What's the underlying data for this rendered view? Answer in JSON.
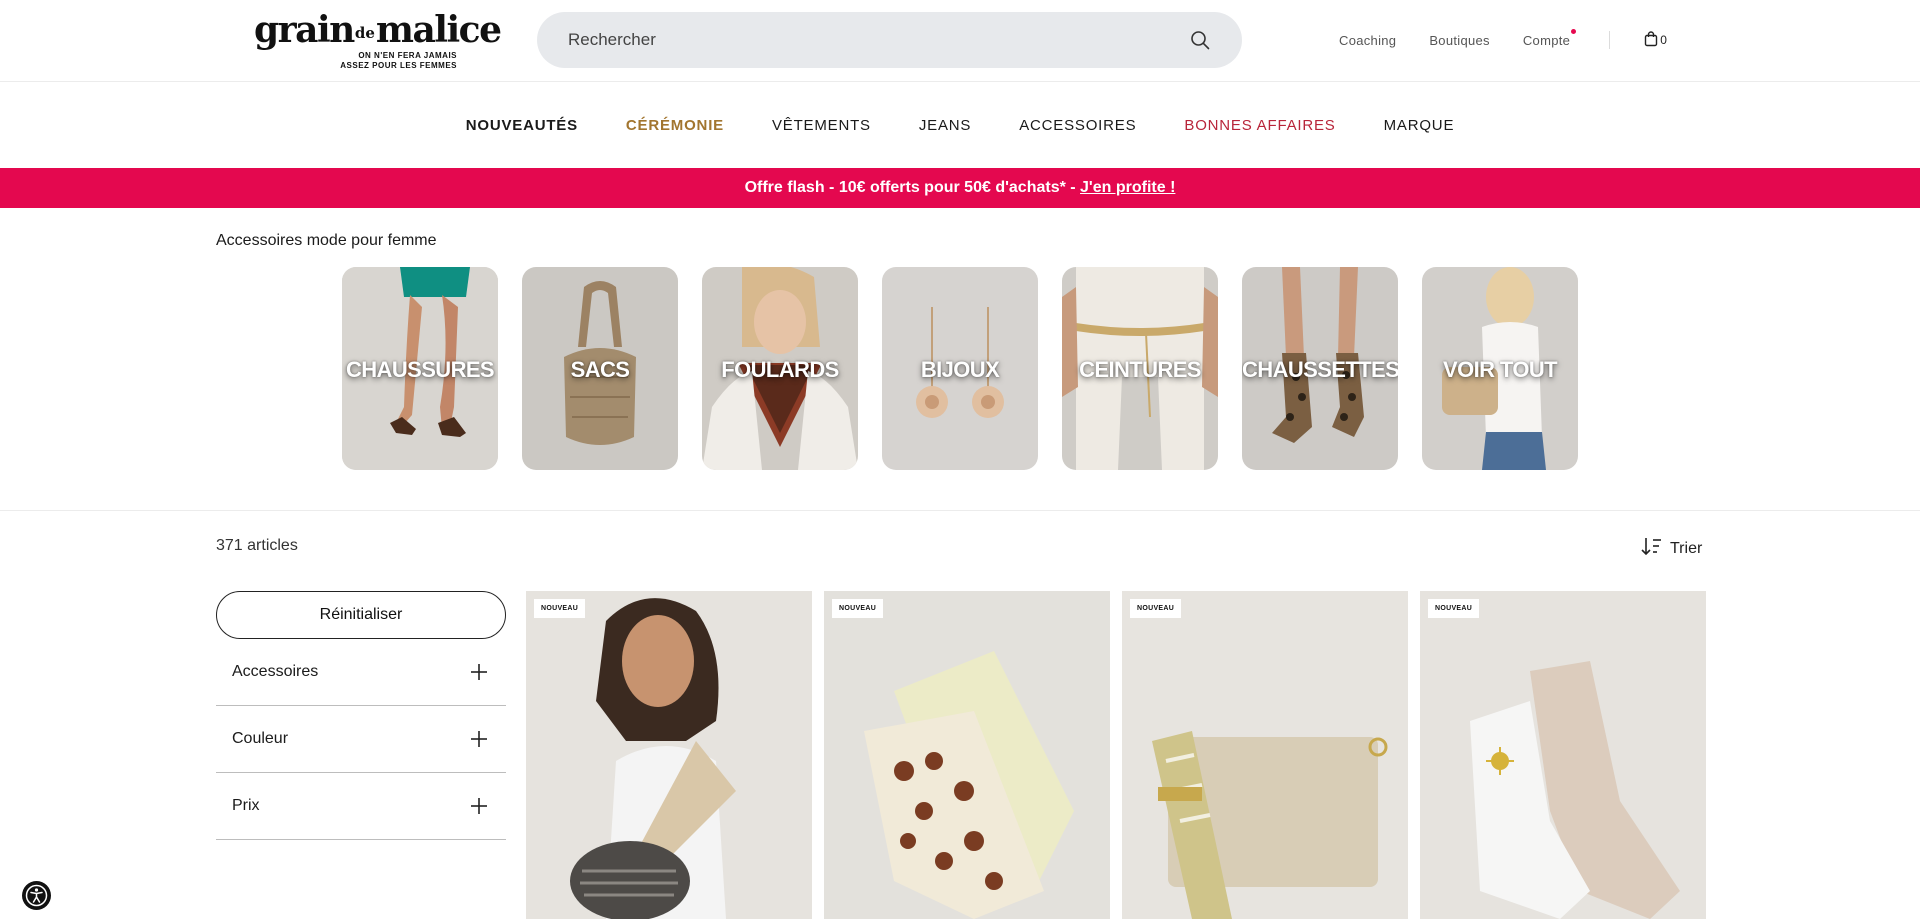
{
  "header": {
    "logo": {
      "word1": "grain",
      "word_de": "de",
      "word2": "malice",
      "tagline_1": "ON N'EN FERA JAMAIS",
      "tagline_2": "ASSEZ POUR LES FEMMES"
    },
    "search": {
      "placeholder": "Rechercher"
    },
    "links": {
      "coaching": "Coaching",
      "boutiques": "Boutiques",
      "compte": "Compte"
    },
    "cart_count": "0"
  },
  "nav": {
    "items": [
      {
        "label": "NOUVEAUTÉS"
      },
      {
        "label": "CÉRÉMONIE"
      },
      {
        "label": "VÊTEMENTS"
      },
      {
        "label": "JEANS"
      },
      {
        "label": "ACCESSOIRES"
      },
      {
        "label": "BONNES AFFAIRES"
      },
      {
        "label": "MARQUE"
      }
    ]
  },
  "promo": {
    "text": "Offre flash - 10€ offerts pour 50€ d'achats* - ",
    "link": "J'en profite !",
    "color": "#e4084f"
  },
  "categories": {
    "title": "Accessoires mode pour femme",
    "items": [
      {
        "label": "CHAUSSURES"
      },
      {
        "label": "SACS"
      },
      {
        "label": "FOULARDS"
      },
      {
        "label": "BIJOUX"
      },
      {
        "label": "CEINTURES"
      },
      {
        "label": "CHAUSSETTES"
      },
      {
        "label": "VOIR TOUT"
      }
    ]
  },
  "listing": {
    "count": "371 articles",
    "sort_label": "Trier",
    "reset_label": "Réinitialiser",
    "filters": [
      {
        "label": "Accessoires"
      },
      {
        "label": "Couleur"
      },
      {
        "label": "Prix"
      }
    ],
    "products": [
      {
        "badge": "NOUVEAU"
      },
      {
        "badge": "NOUVEAU"
      },
      {
        "badge": "NOUVEAU"
      },
      {
        "badge": "NOUVEAU"
      }
    ]
  }
}
